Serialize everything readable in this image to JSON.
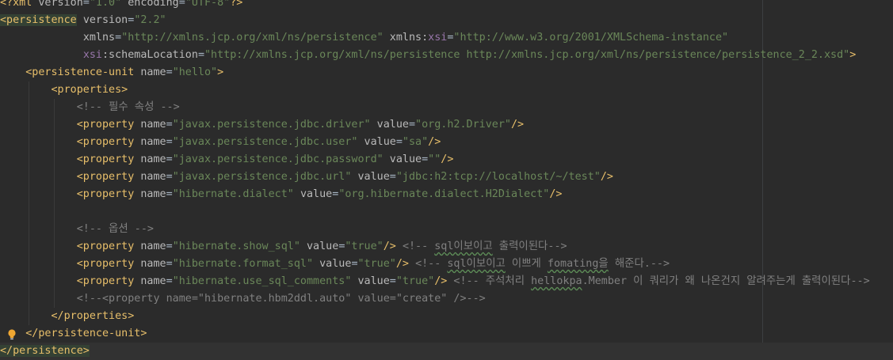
{
  "editor": {
    "lines": [
      {
        "indent": "",
        "tokens": [
          [
            "tag",
            "<?"
          ],
          [
            "tag",
            "xml "
          ],
          [
            "attr",
            "version"
          ],
          [
            "plain",
            "="
          ],
          [
            "val",
            "\"1.0\""
          ],
          [
            "plain",
            " "
          ],
          [
            "attr",
            "encoding"
          ],
          [
            "plain",
            "="
          ],
          [
            "val",
            "\"UTF-8\""
          ],
          [
            "tag",
            "?>"
          ]
        ]
      },
      {
        "indent": "",
        "tokens": [
          [
            "tag hl",
            "<persistence"
          ],
          [
            "plain",
            " "
          ],
          [
            "attr",
            "version"
          ],
          [
            "plain",
            "="
          ],
          [
            "val",
            "\"2.2\""
          ]
        ]
      },
      {
        "indent": "             ",
        "tokens": [
          [
            "attr",
            "xmlns"
          ],
          [
            "plain",
            "="
          ],
          [
            "val",
            "\"http://xmlns.jcp.org/xml/ns/persistence\""
          ],
          [
            "plain",
            " "
          ],
          [
            "attr",
            "xmlns:"
          ],
          [
            "ns",
            "xsi"
          ],
          [
            "plain",
            "="
          ],
          [
            "val",
            "\"http://www.w3.org/2001/XMLSchema-instance\""
          ]
        ]
      },
      {
        "indent": "             ",
        "tokens": [
          [
            "ns",
            "xsi"
          ],
          [
            "attr",
            ":schemaLocation"
          ],
          [
            "plain",
            "="
          ],
          [
            "val",
            "\"http://xmlns.jcp.org/xml/ns/persistence http://xmlns.jcp.org/xml/ns/persistence/persistence_2_2.xsd\""
          ],
          [
            "tag",
            ">"
          ]
        ]
      },
      {
        "indent": "    ",
        "tokens": [
          [
            "tag",
            "<persistence-unit "
          ],
          [
            "attr",
            "name"
          ],
          [
            "plain",
            "="
          ],
          [
            "val",
            "\"hello\""
          ],
          [
            "tag",
            ">"
          ]
        ]
      },
      {
        "indent": "        ",
        "tokens": [
          [
            "tag",
            "<properties>"
          ]
        ]
      },
      {
        "indent": "            ",
        "tokens": [
          [
            "com",
            "<!-- 필수 속성 -->"
          ]
        ]
      },
      {
        "indent": "            ",
        "tokens": [
          [
            "tag",
            "<property "
          ],
          [
            "attr",
            "name"
          ],
          [
            "plain",
            "="
          ],
          [
            "val",
            "\"javax.persistence.jdbc.driver\""
          ],
          [
            "plain",
            " "
          ],
          [
            "attr",
            "value"
          ],
          [
            "plain",
            "="
          ],
          [
            "val",
            "\"org.h2.Driver\""
          ],
          [
            "tag",
            "/>"
          ]
        ]
      },
      {
        "indent": "            ",
        "tokens": [
          [
            "tag",
            "<property "
          ],
          [
            "attr",
            "name"
          ],
          [
            "plain",
            "="
          ],
          [
            "val",
            "\"javax.persistence.jdbc.user\""
          ],
          [
            "plain",
            " "
          ],
          [
            "attr",
            "value"
          ],
          [
            "plain",
            "="
          ],
          [
            "val",
            "\"sa\""
          ],
          [
            "tag",
            "/>"
          ]
        ]
      },
      {
        "indent": "            ",
        "tokens": [
          [
            "tag",
            "<property "
          ],
          [
            "attr",
            "name"
          ],
          [
            "plain",
            "="
          ],
          [
            "val",
            "\"javax.persistence.jdbc.password\""
          ],
          [
            "plain",
            " "
          ],
          [
            "attr",
            "value"
          ],
          [
            "plain",
            "="
          ],
          [
            "val",
            "\"\""
          ],
          [
            "tag",
            "/>"
          ]
        ]
      },
      {
        "indent": "            ",
        "tokens": [
          [
            "tag",
            "<property "
          ],
          [
            "attr",
            "name"
          ],
          [
            "plain",
            "="
          ],
          [
            "val",
            "\"javax.persistence.jdbc.url\""
          ],
          [
            "plain",
            " "
          ],
          [
            "attr",
            "value"
          ],
          [
            "plain",
            "="
          ],
          [
            "val",
            "\"jdbc:h2:tcp://localhost/~/test\""
          ],
          [
            "tag",
            "/>"
          ]
        ]
      },
      {
        "indent": "            ",
        "tokens": [
          [
            "tag",
            "<property "
          ],
          [
            "attr",
            "name"
          ],
          [
            "plain",
            "="
          ],
          [
            "val",
            "\"hibernate.dialect\""
          ],
          [
            "plain",
            " "
          ],
          [
            "attr",
            "value"
          ],
          [
            "plain",
            "="
          ],
          [
            "val",
            "\"org.hibernate.dialect.H2Dialect\""
          ],
          [
            "tag",
            "/>"
          ]
        ]
      },
      {
        "indent": "",
        "tokens": []
      },
      {
        "indent": "            ",
        "tokens": [
          [
            "com",
            "<!-- 옵션 -->"
          ]
        ]
      },
      {
        "indent": "            ",
        "tokens": [
          [
            "tag",
            "<property "
          ],
          [
            "attr",
            "name"
          ],
          [
            "plain",
            "="
          ],
          [
            "val",
            "\"hibernate.show_sql\""
          ],
          [
            "plain",
            " "
          ],
          [
            "attr",
            "value"
          ],
          [
            "plain",
            "="
          ],
          [
            "val",
            "\"true\""
          ],
          [
            "tag",
            "/>"
          ],
          [
            "plain",
            " "
          ],
          [
            "com",
            "<!-- "
          ],
          [
            "com typo",
            "sql이보이고"
          ],
          [
            "com",
            " 출력이된다-->"
          ]
        ]
      },
      {
        "indent": "            ",
        "tokens": [
          [
            "tag",
            "<property "
          ],
          [
            "attr",
            "name"
          ],
          [
            "plain",
            "="
          ],
          [
            "val",
            "\"hibernate.format_sql\""
          ],
          [
            "plain",
            " "
          ],
          [
            "attr",
            "value"
          ],
          [
            "plain",
            "="
          ],
          [
            "val",
            "\"true\""
          ],
          [
            "tag",
            "/>"
          ],
          [
            "plain",
            " "
          ],
          [
            "com",
            "<!-- "
          ],
          [
            "com typo",
            "sql이보이고"
          ],
          [
            "com",
            " 이쁘게 "
          ],
          [
            "com typo",
            "fomating을"
          ],
          [
            "com",
            " 해준다.-->"
          ]
        ]
      },
      {
        "indent": "            ",
        "tokens": [
          [
            "tag",
            "<property "
          ],
          [
            "attr",
            "name"
          ],
          [
            "plain",
            "="
          ],
          [
            "val",
            "\"hibernate.use_sql_comments\""
          ],
          [
            "plain",
            " "
          ],
          [
            "attr",
            "value"
          ],
          [
            "plain",
            "="
          ],
          [
            "val",
            "\"true\""
          ],
          [
            "tag",
            "/>"
          ],
          [
            "plain",
            " "
          ],
          [
            "com",
            "<!-- 주석처리 "
          ],
          [
            "com typo",
            "hellokpa"
          ],
          [
            "com",
            ".Member 이 쿼리가 왜 나온건지 알려주는게 출력이된다-->"
          ]
        ]
      },
      {
        "indent": "            ",
        "tokens": [
          [
            "com",
            "<!--<property name=\"hibernate.hbm2ddl.auto\" value=\"create\" />-->"
          ]
        ]
      },
      {
        "indent": "        ",
        "tokens": [
          [
            "tag",
            "</properties>"
          ]
        ]
      },
      {
        "indent": "    ",
        "tokens": [
          [
            "tag",
            "</persistence-unit>"
          ]
        ]
      },
      {
        "indent": "",
        "tokens": [
          [
            "tag hl",
            "</persistence>"
          ]
        ]
      }
    ]
  },
  "intention": {
    "icon": "lightbulb-icon"
  }
}
